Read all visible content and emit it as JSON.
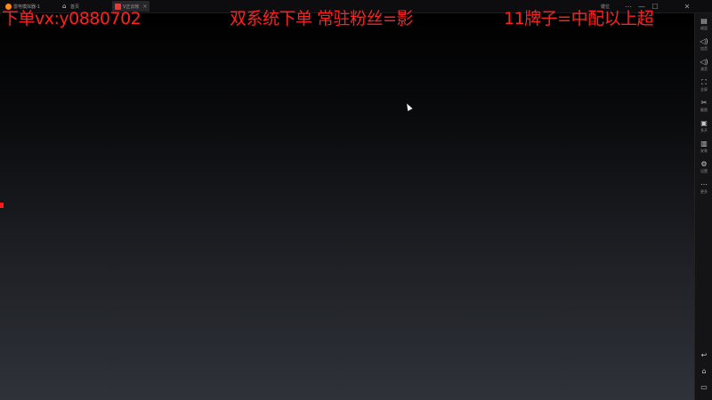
{
  "titlebar": {
    "tabs": [
      {
        "label": "雷电模拟器-1",
        "icon": "emulator-logo-icon"
      },
      {
        "label": "首页",
        "icon": "home-icon"
      },
      {
        "label": "V正云帐",
        "icon": "app-icon",
        "close": "×"
      }
    ],
    "window_controls": [
      "键位",
      "⋯",
      "—",
      "☐",
      "✕"
    ]
  },
  "overlay": {
    "left_text": "下单vx:y0880702",
    "center_text": "双系统下单  常驻粉丝=影",
    "right_text": "11牌子=中配以上超",
    "color": "#ff2020"
  },
  "sidebar": {
    "items": [
      {
        "icon": "▤",
        "label": "键盘"
      },
      {
        "icon": "◁)",
        "label": "加音"
      },
      {
        "icon": "◁)",
        "label": "减音"
      },
      {
        "icon": "⛶",
        "label": "全屏"
      },
      {
        "icon": "✂",
        "label": "截图"
      },
      {
        "icon": "▣",
        "label": "多开"
      },
      {
        "icon": "▥",
        "label": "安装"
      },
      {
        "icon": "⚙",
        "label": "设置"
      },
      {
        "icon": "⋯",
        "label": "更多"
      }
    ],
    "bottom": [
      {
        "icon": "↩"
      },
      {
        "icon": "⌂"
      },
      {
        "icon": "▭"
      }
    ]
  }
}
